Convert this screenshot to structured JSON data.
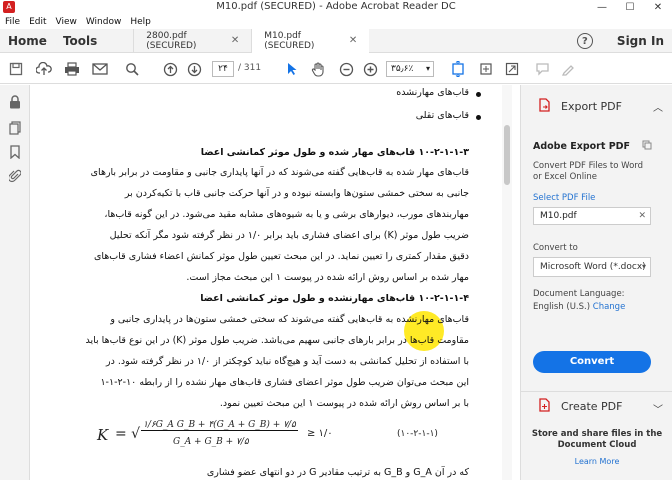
{
  "window": {
    "title": "M10.pdf (SECURED) - Adobe Acrobat Reader DC",
    "minimize": "—",
    "maximize": "☐",
    "close": "✕"
  },
  "menu": [
    "File",
    "Edit",
    "View",
    "Window",
    "Help"
  ],
  "nav": {
    "home": "Home",
    "tools": "Tools"
  },
  "tabs": [
    {
      "label": "2800.pdf (SECURED)",
      "close": "✕",
      "active": false
    },
    {
      "label": "M10.pdf (SECURED)",
      "close": "✕",
      "active": true
    }
  ],
  "header": {
    "help": "?",
    "sign_in": "Sign In"
  },
  "toolbar": {
    "page_current": "۲۴",
    "page_total": "/ 311",
    "zoom": "۳۵٫۶٪",
    "zoom_caret": "▾"
  },
  "document": {
    "bullets": [
      "قاب‌های مهارنشده",
      "قاب‌های تقلی"
    ],
    "lines": [
      {
        "text": "۱۰-۲-۱-۱-۳ قاب‌های مهار شده و طول موثر کمانشی اعضا",
        "bold": true
      },
      {
        "text": "قاب‌های مهار شده به قاب‌هایی گفته می‌شوند که در آنها پایداری جانبی و مقاومت در برابر بارهای",
        "bold": false
      },
      {
        "text": "جانبی به سختی خمشی ستون‌ها وابسته نبوده و در آنها حرکت جانبی قاب با تکیه‌کردن بر",
        "bold": false
      },
      {
        "text": "مهاربندهای مورب، دیوارهای برشی و یا به شیوه‌های مشابه مقید می‌شود. در این گونه قاب‌ها،",
        "bold": false
      },
      {
        "text": "ضریب طول موثر (K) برای اعضای فشاری باید برابر ۱/۰ در نظر گرفته شود مگر آنکه تحلیل",
        "bold": false
      },
      {
        "text": "دقیق مقدار کمتری را تعیین نماید. در این مبحث تعیین طول موثر کمانش اعضاء فشاری قاب‌های",
        "bold": false
      },
      {
        "text": "مهار شده بر اساس روش ارائه شده در پیوست ۱ این مبحث مجاز است.",
        "bold": false
      },
      {
        "text": "۱۰-۲-۱-۱-۴ قاب‌های مهارنشده و طول موثر کمانشی اعضا",
        "bold": true
      },
      {
        "text": "قاب‌های مهارنشده به قاب‌هایی گفته می‌شوند که سختی خمشی ستون‌ها در پایداری جانبی و",
        "bold": false
      },
      {
        "text": "مقاومت قاب‌ها در برابر بارهای جانبی سهیم می‌باشد. ضریب طول موثر (K) در این نوع قاب‌ها باید",
        "bold": false
      },
      {
        "text": "با استفاده از تحلیل کمانشی به دست آید و هیچ‌گاه نباید کوچکتر از ۱/۰ در نظر گرفته شود. در",
        "bold": false
      },
      {
        "text": "این مبحث می‌توان ضریب طول موثر اعضای فشاری قاب‌های مهار نشده را از رابطه ۱۰-۲-۱-۱",
        "bold": false
      },
      {
        "text": "با بر اساس روش ارائه شده در پیوست ۱ این مبحث تعیین نمود.",
        "bold": false
      }
    ],
    "formula": {
      "lhs": "K",
      "eq": "= √",
      "numerator": "۱/۶G_A G_B + ۴(G_A + G_B) + ۷/۵",
      "denominator": "G_A + G_B + ۷/۵",
      "rhs": "≥ ۱/۰",
      "tag": "(۱۰-۲-۱-۱)"
    },
    "footer_line": "که در آن G_A و G_B به ترتیب مقادیر G در دو انتهای عضو فشاری"
  },
  "panel": {
    "export_label": "Export PDF",
    "export_chevron": "︿",
    "title": "Adobe Export PDF",
    "desc1": "Convert PDF Files to Word",
    "desc2": "or Excel Online",
    "select_label": "Select PDF File",
    "file_name": "M10.pdf",
    "file_clear": "✕",
    "convert_to_label": "Convert to",
    "convert_to_value": "Microsoft Word (*.docx)",
    "convert_caret": "▾",
    "lang_label": "Document Language:",
    "lang_value": "English (U.S.)",
    "lang_change": "Change",
    "convert_button": "Convert",
    "create_label": "Create PDF",
    "create_chevron": "﹀",
    "cloud_line1": "Store and share files in the",
    "cloud_line2": "Document Cloud",
    "learn_more": "Learn More"
  },
  "colors": {
    "accent": "#1473e6",
    "brand": "#d32020"
  }
}
